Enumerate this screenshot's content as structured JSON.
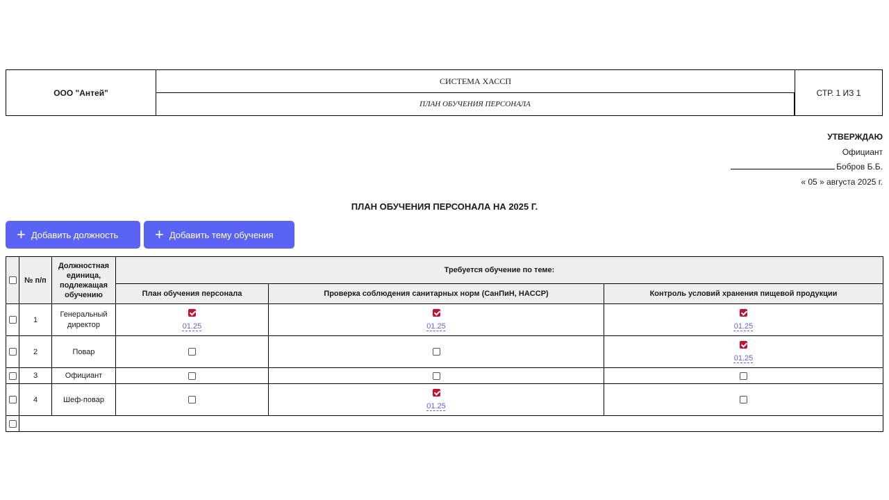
{
  "header": {
    "org": "ООО \"Антей\"",
    "system": "СИСТЕМА ХАССП",
    "doc": "ПЛАН ОБУЧЕНИЯ ПЕРСОНАЛА",
    "page": "СТР. 1 ИЗ 1"
  },
  "approval": {
    "title": "УТВЕРЖДАЮ",
    "position": "Официант",
    "signer": "Бобров Б.Б.",
    "date": "« 05 » августа 2025 г."
  },
  "plan_title": "ПЛАН ОБУЧЕНИЯ ПЕРСОНАЛА НА 2025 Г.",
  "buttons": {
    "add_position": "Добавить должность",
    "add_topic": "Добавить тему обучения"
  },
  "table": {
    "col_num": "№ п/п",
    "col_position": "Должностная единица, подлежащая обучению",
    "col_required": "Требуется обучение по теме:",
    "topics": [
      "План обучения персонала",
      "Проверка соблюдения санитарных норм (СанПиН, HACCP)",
      "Контроль условий хранения пищевой продукции"
    ],
    "rows": [
      {
        "num": "1",
        "position": "Генеральный директор",
        "c0": "01.25",
        "c1": "01.25",
        "c2": "01.25"
      },
      {
        "num": "2",
        "position": "Повар",
        "c2": "01.25"
      },
      {
        "num": "3",
        "position": "Официант"
      },
      {
        "num": "4",
        "position": "Шеф-повар",
        "c1": "01.25"
      }
    ]
  }
}
